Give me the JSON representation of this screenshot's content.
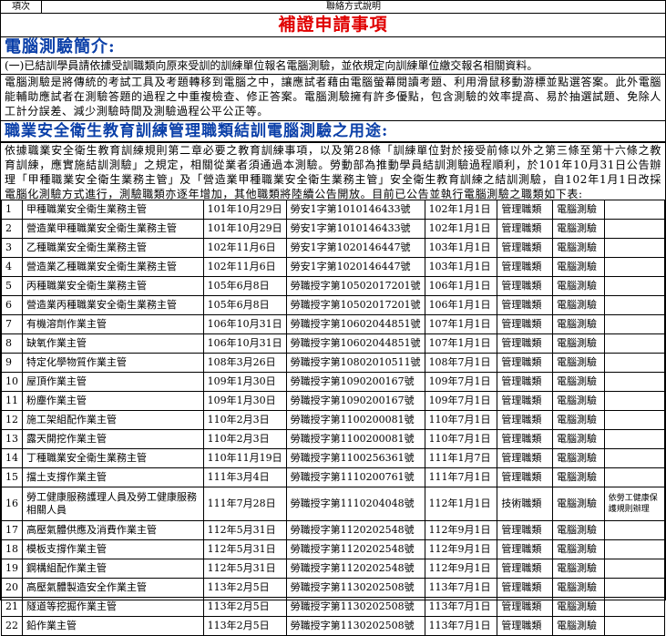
{
  "header": {
    "item_label": "項次",
    "title": "聯絡方式說明"
  },
  "banner": "補證申請事項",
  "section1": {
    "title": "電腦測驗簡介:",
    "line1": "(一)已結訓學員請依據受訓職類向原來受訓的訓練單位報名電腦測驗，並依規定向訓練單位繳交報名相關資料。",
    "para": "電腦測驗是將傳統的考試工具及考題轉移到電腦之中，讓應試者藉由電腦螢幕閱讀考題、利用滑鼠移動游標並點選答案。此外電腦能輔助應試者在測驗答題的過程之中重複檢查、修正答案。電腦測驗擁有許多優點，包含測驗的效率提高、易於抽選試題、免除人工計分誤差、減少測驗時間及測驗過程公平公正等。"
  },
  "section2": {
    "title": "職業安全衛生教育訓練管理職類結訓電腦測驗之用途:",
    "para": "依據職業安全衛生教育訓練規則第二章必要之教育訓練事項，以及第28條「訓練單位對於接受前條以外之第三條至第十六條之教育訓練，應實施結訓測驗」之規定，相關從業者須通過本測驗。勞動部為推動學員結訓測驗過程順利，於101年10月31日公告辦理「甲種職業安全衛生業務主管」及「營造業甲種職業安全衛生業務主管」安全衛生教育訓練之結訓測驗，自102年1月1日改採電腦化測驗方式進行，測驗職類亦逐年增加，其他職類將陸續公告開放。目前已公告並執行電腦測驗之職類如下表:"
  },
  "table": {
    "rows": [
      {
        "idx": "1",
        "name": "甲種職業安全衛生業務主管",
        "date": "101年10月29日",
        "doc": "勞安1字第1010146433號",
        "eff": "102年1月1日",
        "cat": "管理職類",
        "method": "電腦測驗",
        "note": ""
      },
      {
        "idx": "2",
        "name": "營造業甲種職業安全衛生業務主管",
        "date": "101年10月29日",
        "doc": "勞安1字第1010146433號",
        "eff": "102年1月1日",
        "cat": "管理職類",
        "method": "電腦測驗",
        "note": ""
      },
      {
        "idx": "3",
        "name": "乙種職業安全衛生業務主管",
        "date": "102年11月6日",
        "doc": "勞安1字第1020146447號",
        "eff": "103年1月1日",
        "cat": "管理職類",
        "method": "電腦測驗",
        "note": ""
      },
      {
        "idx": "4",
        "name": "營造業乙種職業安全衛生業務主管",
        "date": "102年11月6日",
        "doc": "勞安1字第1020146447號",
        "eff": "103年1月1日",
        "cat": "管理職類",
        "method": "電腦測驗",
        "note": ""
      },
      {
        "idx": "5",
        "name": "丙種職業安全衛生業務主管",
        "date": "105年6月8日",
        "doc": "勞職授字第10502017201號",
        "eff": "106年1月1日",
        "cat": "管理職類",
        "method": "電腦測驗",
        "note": ""
      },
      {
        "idx": "6",
        "name": "營造業丙種職業安全衛生業務主管",
        "date": "105年6月8日",
        "doc": "勞職授字第10502017201號",
        "eff": "106年1月1日",
        "cat": "管理職類",
        "method": "電腦測驗",
        "note": ""
      },
      {
        "idx": "7",
        "name": "有機溶劑作業主管",
        "date": "106年10月31日",
        "doc": "勞職授字第10602044851號",
        "eff": "107年1月1日",
        "cat": "管理職類",
        "method": "電腦測驗",
        "note": ""
      },
      {
        "idx": "8",
        "name": "缺氧作業主管",
        "date": "106年10月31日",
        "doc": "勞職授字第10602044851號",
        "eff": "107年1月1日",
        "cat": "管理職類",
        "method": "電腦測驗",
        "note": ""
      },
      {
        "idx": "9",
        "name": "特定化學物質作業主管",
        "date": "108年3月26日",
        "doc": "勞職授字第10802010511號",
        "eff": "108年7月1日",
        "cat": "管理職類",
        "method": "電腦測驗",
        "note": ""
      },
      {
        "idx": "10",
        "name": "屋頂作業主管",
        "date": "109年1月30日",
        "doc": "勞職授字第1090200167號",
        "eff": "109年7月1日",
        "cat": "管理職類",
        "method": "電腦測驗",
        "note": ""
      },
      {
        "idx": "11",
        "name": "粉塵作業主管",
        "date": "109年1月30日",
        "doc": "勞職授字第1090200167號",
        "eff": "109年7月1日",
        "cat": "管理職類",
        "method": "電腦測驗",
        "note": ""
      },
      {
        "idx": "12",
        "name": "施工架組配作業主管",
        "date": "110年2月3日",
        "doc": "勞職授字第1100200081號",
        "eff": "110年7月1日",
        "cat": "管理職類",
        "method": "電腦測驗",
        "note": ""
      },
      {
        "idx": "13",
        "name": "露天開挖作業主管",
        "date": "110年2月3日",
        "doc": "勞職授字第1100200081號",
        "eff": "110年7月1日",
        "cat": "管理職類",
        "method": "電腦測驗",
        "note": ""
      },
      {
        "idx": "14",
        "name": "丁種職業安全衛生業務主管",
        "date": "110年11月19日",
        "doc": "勞職授字第1100256361號",
        "eff": "111年1月7日",
        "cat": "管理職類",
        "method": "電腦測驗",
        "note": ""
      },
      {
        "idx": "15",
        "name": "擋土支撐作業主管",
        "date": "111年3月4日",
        "doc": "勞職授字第1110200761號",
        "eff": "111年7月1日",
        "cat": "管理職類",
        "method": "電腦測驗",
        "note": ""
      },
      {
        "idx": "16",
        "name": "勞工健康服務護理人員及勞工健康服務相關人員",
        "date": "111年7月28日",
        "doc": "勞職授字第1110204048號",
        "eff": "112年1月1日",
        "cat": "技術職類",
        "method": "電腦測驗",
        "note": "依勞工健康保護規則辦理"
      },
      {
        "idx": "17",
        "name": "高壓氣體供應及消費作業主管",
        "date": "112年5月31日",
        "doc": "勞職授字第1120202548號",
        "eff": "112年9月1日",
        "cat": "管理職類",
        "method": "電腦測驗",
        "note": ""
      },
      {
        "idx": "18",
        "name": "模板支撐作業主管",
        "date": "112年5月31日",
        "doc": "勞職授字第1120202548號",
        "eff": "112年9月1日",
        "cat": "管理職類",
        "method": "電腦測驗",
        "note": ""
      },
      {
        "idx": "19",
        "name": "鋼構組配作業主管",
        "date": "112年5月31日",
        "doc": "勞職授字第1120202548號",
        "eff": "112年9月1日",
        "cat": "管理職類",
        "method": "電腦測驗",
        "note": ""
      },
      {
        "idx": "20",
        "name": "高壓氣體製造安全作業主管",
        "date": "113年2月5日",
        "doc": "勞職授字第1130202508號",
        "eff": "113年7月1日",
        "cat": "管理職類",
        "method": "電腦測驗",
        "note": ""
      },
      {
        "idx": "21",
        "name": "隧道等挖掘作業主管",
        "date": "113年2月5日",
        "doc": "勞職授字第1130202508號",
        "eff": "113年7月1日",
        "cat": "管理職類",
        "method": "電腦測驗",
        "note": ""
      },
      {
        "idx": "22",
        "name": "鉛作業主管",
        "date": "113年2月5日",
        "doc": "勞職授字第1130202508號",
        "eff": "113年7月1日",
        "cat": "管理職類",
        "method": "電腦測驗",
        "note": ""
      }
    ]
  }
}
